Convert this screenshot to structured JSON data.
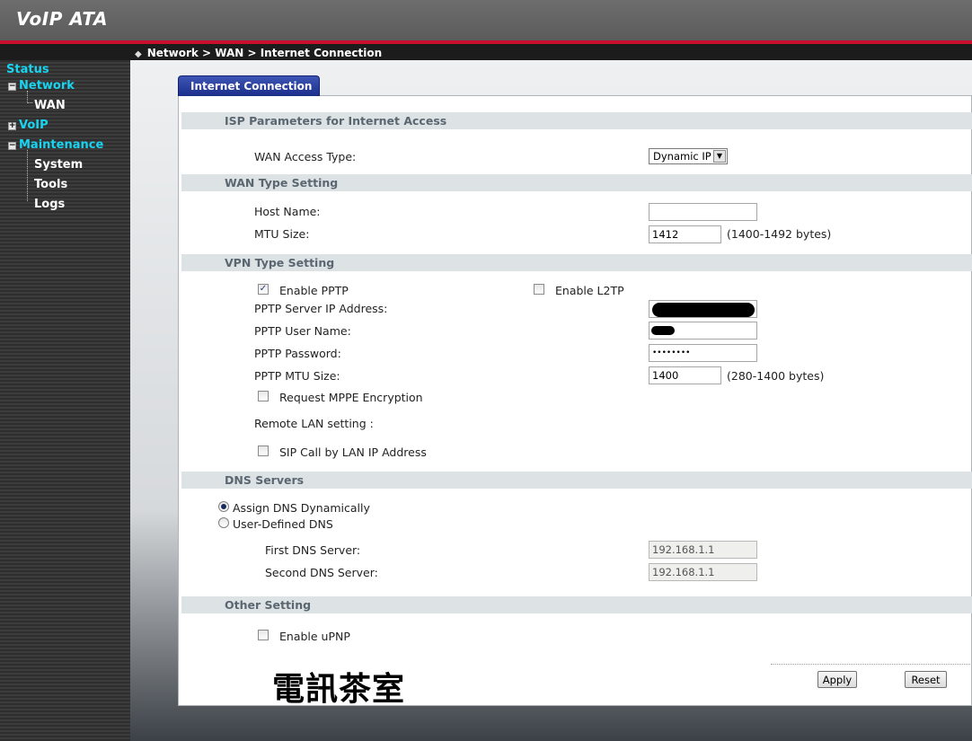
{
  "app": {
    "title": "VoIP ATA"
  },
  "breadcrumb": "Network > WAN > Internet Connection",
  "sidebar": {
    "items": [
      {
        "label": "Status",
        "tree": ""
      },
      {
        "label": "Network",
        "tree": "−"
      },
      {
        "label": "WAN",
        "tree": ""
      },
      {
        "label": "VoIP",
        "tree": "+"
      },
      {
        "label": "Maintenance",
        "tree": "−"
      },
      {
        "label": "System",
        "tree": ""
      },
      {
        "label": "Tools",
        "tree": ""
      },
      {
        "label": "Logs",
        "tree": ""
      }
    ]
  },
  "tab": {
    "label": "Internet Connection"
  },
  "isp": {
    "section": "ISP Parameters for Internet Access",
    "wan_access_label": "WAN Access Type:",
    "wan_access_value": "Dynamic IP"
  },
  "wan_type": {
    "section": "WAN Type Setting",
    "host_label": "Host Name:",
    "host_value": "",
    "mtu_label": "MTU Size:",
    "mtu_value": "1412",
    "mtu_range": "(1400-1492 bytes)"
  },
  "vpn": {
    "section": "VPN Type Setting",
    "enable_pptp": "Enable PPTP",
    "enable_pptp_checked": true,
    "enable_l2tp": "Enable L2TP",
    "enable_l2tp_checked": false,
    "server_ip_label": "PPTP Server IP Address:",
    "user_label": "PPTP User Name:",
    "password_label": "PPTP Password:",
    "password_value": "••••••••",
    "mtu_label": "PPTP MTU Size:",
    "mtu_value": "1400",
    "mtu_range": "(280-1400 bytes)",
    "mppe_label": "Request MPPE Encryption",
    "remote_lan_label": "Remote LAN setting :",
    "sip_lan_label": "SIP Call by LAN IP Address"
  },
  "dns": {
    "section": "DNS Servers",
    "assign_dynamic": "Assign DNS Dynamically",
    "user_defined": "User-Defined DNS",
    "selected": "assign_dynamic",
    "first_label": "First DNS Server:",
    "first_value": "192.168.1.1",
    "second_label": "Second DNS Server:",
    "second_value": "192.168.1.1"
  },
  "other": {
    "section": "Other Setting",
    "upnp_label": "Enable uPNP",
    "upnp_checked": false
  },
  "buttons": {
    "apply": "Apply",
    "reset": "Reset"
  },
  "watermark": "電訊茶室",
  "colors": {
    "accent_red": "#c8102e",
    "nav_cyan": "#19d4f0",
    "tab_blue": "#1b2f8a",
    "section_bg": "#dde3e5"
  }
}
